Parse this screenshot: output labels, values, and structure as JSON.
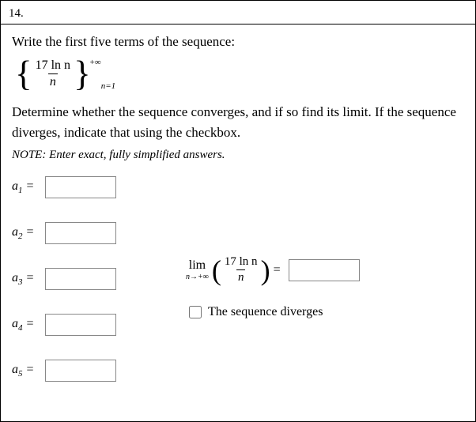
{
  "problem_number": "14.",
  "instruction1": "Write the first five terms of the sequence:",
  "sequence": {
    "numerator": "17 ln n",
    "denominator": "n",
    "upper_bound": "+∞",
    "lower_bound": "n=1"
  },
  "instruction2": "Determine whether the sequence converges, and if so find its limit. If the sequence diverges, indicate that using the checkbox.",
  "note": "NOTE:  Enter exact, fully simplified answers.",
  "terms": [
    {
      "label_var": "a",
      "label_sub": "1",
      "value": ""
    },
    {
      "label_var": "a",
      "label_sub": "2",
      "value": ""
    },
    {
      "label_var": "a",
      "label_sub": "3",
      "value": ""
    },
    {
      "label_var": "a",
      "label_sub": "4",
      "value": ""
    },
    {
      "label_var": "a",
      "label_sub": "5",
      "value": ""
    }
  ],
  "limit": {
    "lim_text": "lim",
    "lim_sub": "n→+∞",
    "numerator": "17 ln n",
    "denominator": "n",
    "value": ""
  },
  "diverges_label": "The sequence diverges",
  "diverges_checked": false
}
